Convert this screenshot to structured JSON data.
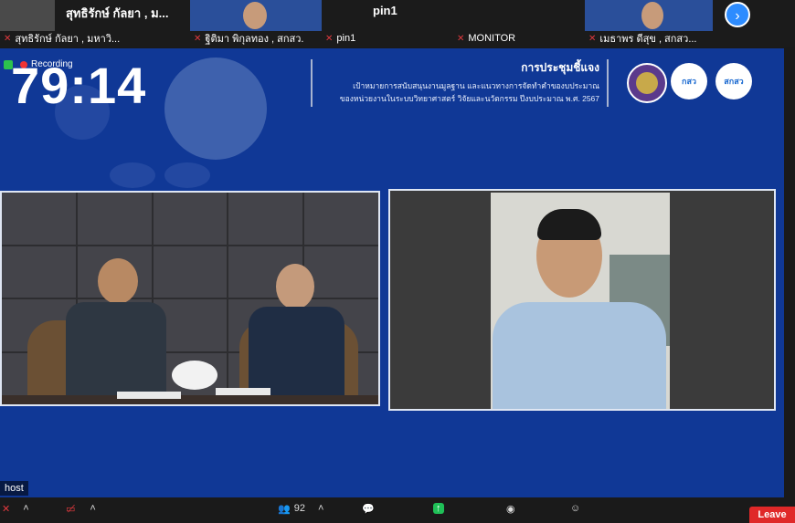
{
  "participants": [
    {
      "display_name": "สุทธิรักษ์ กัลยา , ม...",
      "caption": "สุทธิรักษ์ กัลยา , มหาวิ..."
    },
    {
      "display_name": "",
      "caption": "ฐิติมา พิกุลทอง , สกสว."
    },
    {
      "display_name": "pin1",
      "caption": "pin1"
    },
    {
      "display_name": "",
      "caption": "MONITOR"
    },
    {
      "display_name": "",
      "caption": "เมธาพร ดีสุข , สกสว..."
    }
  ],
  "recording_label": "Recording",
  "timer": "79:14",
  "slide": {
    "title": "การประชุมชี้แจง",
    "subtitle_line1": "เป้าหมายการสนับสนุนงานมูลฐาน และแนวทางการจัดทำคำของบประมาณ",
    "subtitle_line2": "ของหน่วยงานในระบบวิทยาศาสตร์ วิจัยและนวัตกรรม ปีงบประมาณ พ.ศ. 2567",
    "logos": [
      {
        "name": "ministry-seal",
        "text": ""
      },
      {
        "name": "pmu-logo",
        "text": "กสว"
      },
      {
        "name": "tsri-logo",
        "text": "สกสว"
      }
    ]
  },
  "host_label": "host",
  "toolbar": {
    "participants_count": "92",
    "leave_label": "Leave"
  },
  "colors": {
    "accent": "#2d8cff",
    "slide_bg": "#103896",
    "leave": "#e02828",
    "mic_muted": "#e0393e"
  }
}
